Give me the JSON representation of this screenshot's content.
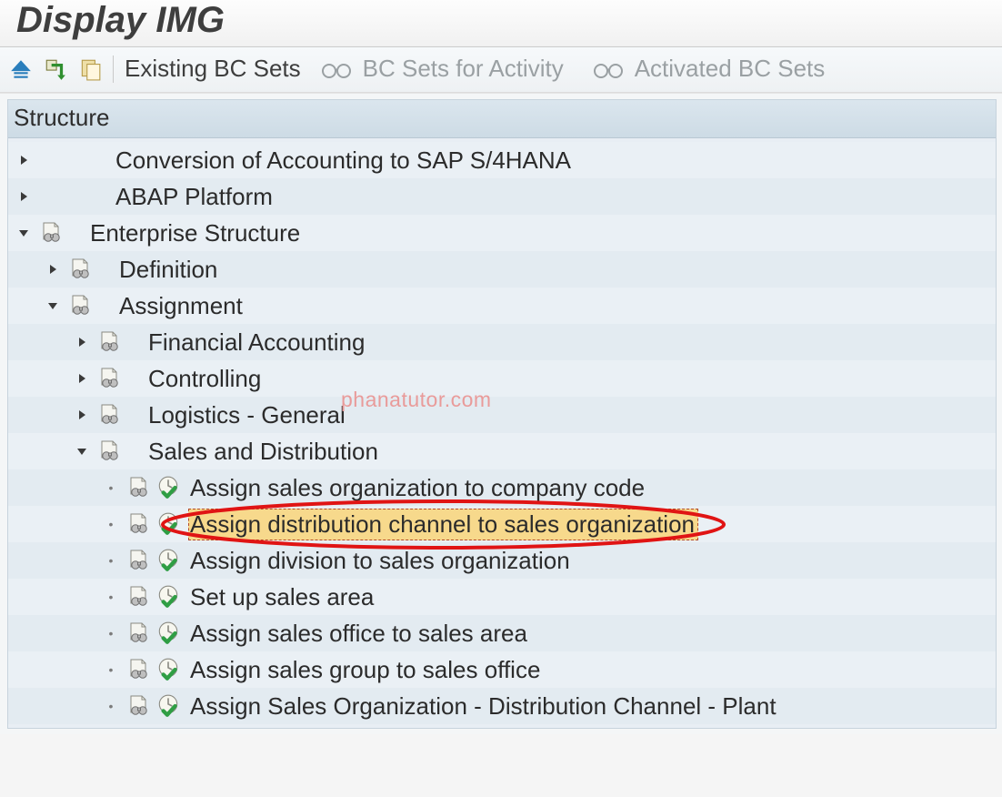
{
  "title": "Display IMG",
  "toolbar": {
    "existing_bc_sets": "Existing BC Sets",
    "bc_sets_for_activity": "BC Sets for Activity",
    "activated_bc_sets": "Activated BC Sets"
  },
  "panel_header": "Structure",
  "watermark": "phanatutor.com",
  "nodes": [
    {
      "depth": 0,
      "arrow": "right",
      "docIcon": false,
      "exec": false,
      "label": "Conversion of Accounting to SAP S/4HANA"
    },
    {
      "depth": 0,
      "arrow": "right",
      "docIcon": false,
      "exec": false,
      "label": "ABAP Platform"
    },
    {
      "depth": 0,
      "arrow": "down",
      "docIcon": true,
      "exec": false,
      "label": "Enterprise Structure"
    },
    {
      "depth": 1,
      "arrow": "right",
      "docIcon": true,
      "exec": false,
      "label": "Definition"
    },
    {
      "depth": 1,
      "arrow": "down",
      "docIcon": true,
      "exec": false,
      "label": "Assignment"
    },
    {
      "depth": 2,
      "arrow": "right",
      "docIcon": true,
      "exec": false,
      "label": "Financial Accounting"
    },
    {
      "depth": 2,
      "arrow": "right",
      "docIcon": true,
      "exec": false,
      "label": "Controlling"
    },
    {
      "depth": 2,
      "arrow": "right",
      "docIcon": true,
      "exec": false,
      "label": "Logistics - General"
    },
    {
      "depth": 2,
      "arrow": "down",
      "docIcon": true,
      "exec": false,
      "label": "Sales and Distribution"
    },
    {
      "depth": 3,
      "arrow": "bullet",
      "docIcon": true,
      "exec": true,
      "label": "Assign sales organization to company code"
    },
    {
      "depth": 3,
      "arrow": "bullet",
      "docIcon": true,
      "exec": true,
      "label": "Assign distribution channel to sales organization",
      "selected": true
    },
    {
      "depth": 3,
      "arrow": "bullet",
      "docIcon": true,
      "exec": true,
      "label": "Assign division to sales organization"
    },
    {
      "depth": 3,
      "arrow": "bullet",
      "docIcon": true,
      "exec": true,
      "label": "Set up sales area"
    },
    {
      "depth": 3,
      "arrow": "bullet",
      "docIcon": true,
      "exec": true,
      "label": "Assign sales office to sales area"
    },
    {
      "depth": 3,
      "arrow": "bullet",
      "docIcon": true,
      "exec": true,
      "label": "Assign sales group to sales office"
    },
    {
      "depth": 3,
      "arrow": "bullet",
      "docIcon": true,
      "exec": true,
      "label": "Assign Sales Organization - Distribution Channel - Plant"
    }
  ]
}
